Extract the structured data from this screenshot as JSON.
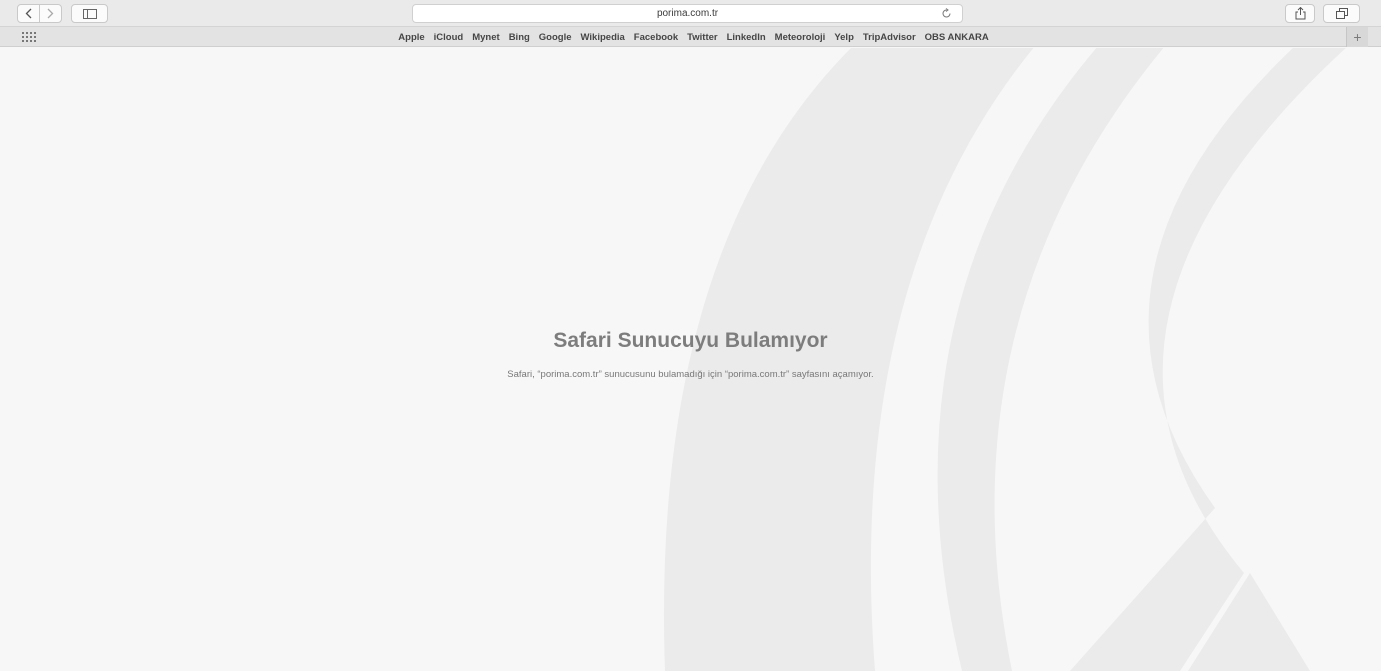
{
  "toolbar": {
    "back_icon": "chevron-left-icon",
    "forward_icon": "chevron-right-icon",
    "sidebar_icon": "sidebar-icon",
    "share_icon": "share-icon",
    "tabs_icon": "tabs-overview-icon",
    "address": "porima.com.tr",
    "reload_icon": "reload-icon"
  },
  "favorites": {
    "grid_icon": "grid-icon",
    "items": [
      {
        "label": "Apple"
      },
      {
        "label": "iCloud"
      },
      {
        "label": "Mynet"
      },
      {
        "label": "Bing"
      },
      {
        "label": "Google"
      },
      {
        "label": "Wikipedia"
      },
      {
        "label": "Facebook"
      },
      {
        "label": "Twitter"
      },
      {
        "label": "LinkedIn"
      },
      {
        "label": "Meteoroloji"
      },
      {
        "label": "Yelp"
      },
      {
        "label": "TripAdvisor"
      },
      {
        "label": "OBS ANKARA"
      }
    ],
    "add_label": "+"
  },
  "error": {
    "title": "Safari Sunucuyu Bulamıyor",
    "description": "Safari, “porima.com.tr” sunucusunu bulamadığı için “porima.com.tr” sayfasını açamıyor."
  },
  "colors": {
    "background": "#f7f7f7",
    "watermark": "#ebebeb",
    "title": "#7d7d7d"
  }
}
